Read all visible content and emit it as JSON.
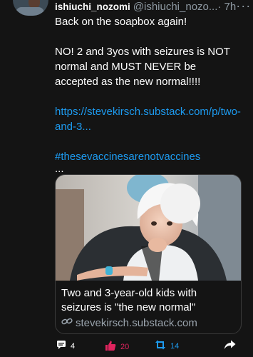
{
  "post": {
    "author_name": "ishiuchi_nozomi",
    "author_handle": "@ishiuchi_nozo...",
    "time": " · 7h",
    "more": "···",
    "line1": "Back on the soapbox again!",
    "line2": "NO! 2 and 3yos with seizures is NOT normal and MUST NEVER be accepted as the new normal!!!!",
    "link_text": "https://stevekirsch.substack.com/p/two-and-3...",
    "hashtag": "#thesevaccinesarenotvaccines",
    "ellipsis": "..."
  },
  "card": {
    "title": "Two and 3-year-old kids with seizures is \"the new normal\"",
    "domain": "stevekirsch.substack.com"
  },
  "actions": {
    "comments": "4",
    "likes": "20",
    "reposts": "14"
  },
  "colors": {
    "background": "#141414",
    "link": "#1d9bf0",
    "muted": "#8f9aa3",
    "like": "#e0245e",
    "repost": "#1d9bf0"
  }
}
